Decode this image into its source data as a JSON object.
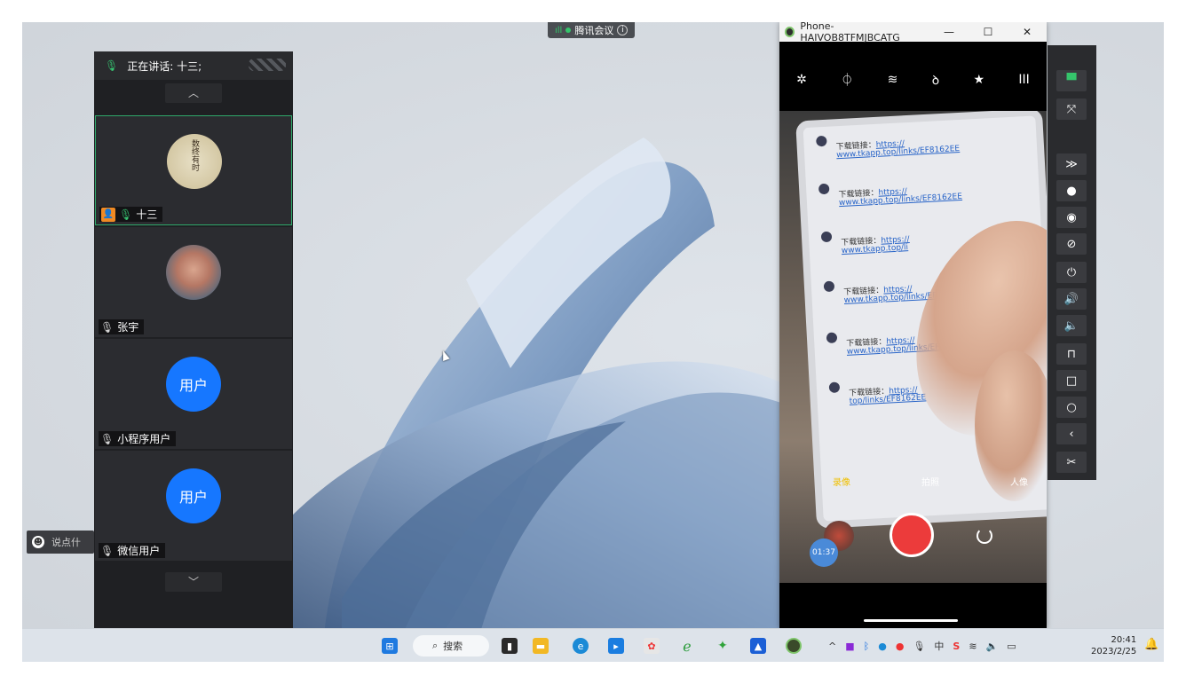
{
  "meeting_tag": {
    "label": "腾讯会议",
    "signal": "ıll"
  },
  "participants_panel": {
    "speaking_label": "正在讲话: 十三;",
    "scroll_up": "︿",
    "scroll_down": "﹀",
    "tiles": [
      {
        "name": "十三",
        "mic": "on",
        "host": true,
        "avatar_type": "seal",
        "seal_text": "数终有时"
      },
      {
        "name": "张宇",
        "mic": "off",
        "host": false,
        "avatar_type": "photo"
      },
      {
        "name": "小程序用户",
        "mic": "off",
        "host": false,
        "avatar_type": "text",
        "avatar_text": "用户"
      },
      {
        "name": "微信用户",
        "mic": "off",
        "host": false,
        "avatar_type": "text",
        "avatar_text": "用户"
      }
    ]
  },
  "chat_input": {
    "placeholder": "说点什"
  },
  "phone_window": {
    "title": "Phone-HAIVOB8TFMJBCATG",
    "controls": {
      "minimize": "—",
      "maximize": "☐",
      "close": "✕"
    },
    "toolbar_icons": [
      "✲",
      "⏀",
      "≋",
      "ꝺ",
      "★",
      "III"
    ],
    "messages": [
      {
        "line1_prefix": "下载链接：",
        "link1": "https://",
        "link2": "www.tkapp.top/links/EF8162EE"
      },
      {
        "line1_prefix": "下载链接：",
        "link1": "https://",
        "link2": "www.tkapp.top/links/EF8162EE"
      },
      {
        "line1_prefix": "下载链接：",
        "link1": "https://",
        "link2": "www.tkapp.top/li"
      },
      {
        "line1_prefix": "下载链接：",
        "link1": "https://",
        "link2": "www.tkapp.top/links/EF8162EE"
      },
      {
        "line1_prefix": "下载链接：",
        "link1": "https://",
        "link2": "www.tkapp.top/links/EF8162EE"
      },
      {
        "line1_prefix": "下载链接：",
        "link1": "https://",
        "link2": "top/links/EF8162EE"
      }
    ],
    "camera_modes": [
      "录像",
      "拍照",
      "人像"
    ],
    "selected_mode": "录像",
    "timer": "01:37"
  },
  "side_toolbar": {
    "buttons": [
      "▀",
      "⤧",
      "≫",
      "●",
      "◉",
      "⊘",
      "⏻",
      "🔊",
      "🔈",
      "⊓",
      "□",
      "○",
      "‹",
      "✂"
    ]
  },
  "taskbar": {
    "search_label": "搜索",
    "clock_time": "20:41",
    "clock_date": "2023/2/25"
  },
  "colors": {
    "accent_green": "#35c46b",
    "user_blue": "#1677ff",
    "shutter_red": "#ec3b3b"
  }
}
